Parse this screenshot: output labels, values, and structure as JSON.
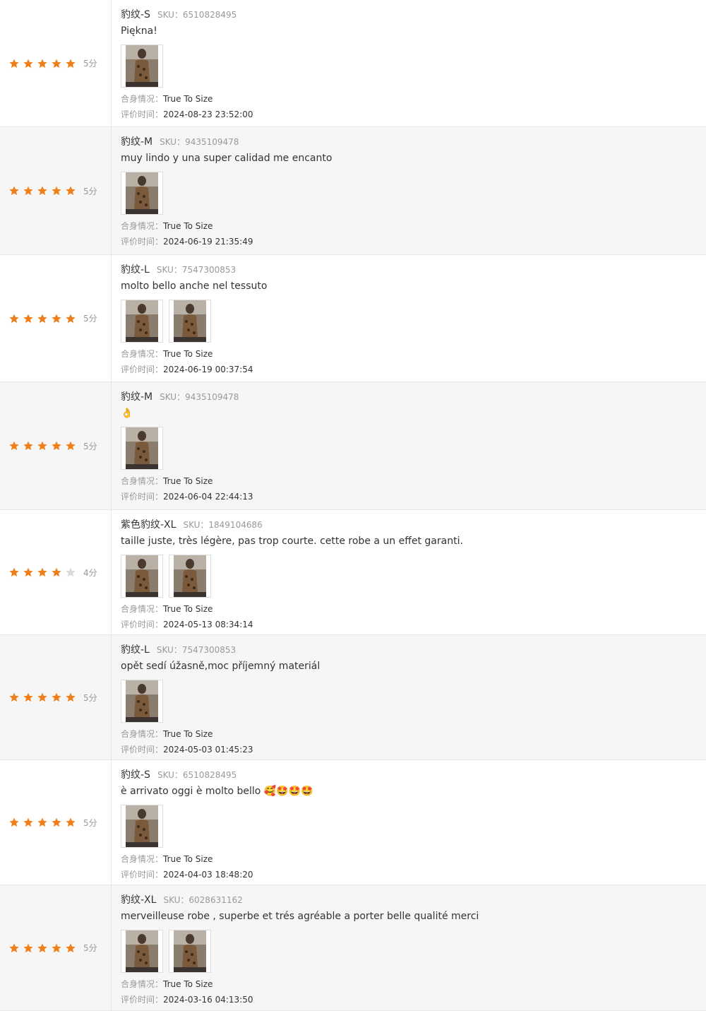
{
  "colors": {
    "star_filled": "#f07f1a",
    "star_empty": "#d9d9d9",
    "text": "#333333",
    "muted": "#999999"
  },
  "labels": {
    "fit": "合身情况：",
    "time": "评价时间："
  },
  "reviews": [
    {
      "stars": 5,
      "score": "5分",
      "variant": "豹纹-S",
      "sku": "SKU：6510828495",
      "text": "Piękna!",
      "photos": 1,
      "fit": "True To Size",
      "time": "2024-08-23 23:52:00"
    },
    {
      "stars": 5,
      "score": "5分",
      "variant": "豹纹-M",
      "sku": "SKU：9435109478",
      "text": "muy lindo y una super calidad me encanto",
      "photos": 1,
      "fit": "True To Size",
      "time": "2024-06-19 21:35:49"
    },
    {
      "stars": 5,
      "score": "5分",
      "variant": "豹纹-L",
      "sku": "SKU：7547300853",
      "text": "molto bello anche nel tessuto",
      "photos": 2,
      "fit": "True To Size",
      "time": "2024-06-19 00:37:54"
    },
    {
      "stars": 5,
      "score": "5分",
      "variant": "豹纹-M",
      "sku": "SKU：9435109478",
      "text": "👌",
      "photos": 1,
      "fit": "True To Size",
      "time": "2024-06-04 22:44:13"
    },
    {
      "stars": 4,
      "score": "4分",
      "variant": "紫色豹纹-XL",
      "sku": "SKU：1849104686",
      "text": "taille juste, très légère, pas trop courte. cette robe a un effet garanti.",
      "photos": 2,
      "fit": "True To Size",
      "time": "2024-05-13 08:34:14"
    },
    {
      "stars": 5,
      "score": "5分",
      "variant": "豹纹-L",
      "sku": "SKU：7547300853",
      "text": "opět sedí úžasně,moc příjemný materiál",
      "photos": 1,
      "fit": "True To Size",
      "time": "2024-05-03 01:45:23"
    },
    {
      "stars": 5,
      "score": "5分",
      "variant": "豹纹-S",
      "sku": "SKU：6510828495",
      "text": "è arrivato oggi è molto bello 🥰🤩🤩🤩",
      "photos": 1,
      "fit": "True To Size",
      "time": "2024-04-03 18:48:20"
    },
    {
      "stars": 5,
      "score": "5分",
      "variant": "豹纹-XL",
      "sku": "SKU：6028631162",
      "text": "merveilleuse robe , superbe et trés agréable a porter belle qualité merci",
      "photos": 2,
      "fit": "True To Size",
      "time": "2024-03-16 04:13:50"
    }
  ]
}
